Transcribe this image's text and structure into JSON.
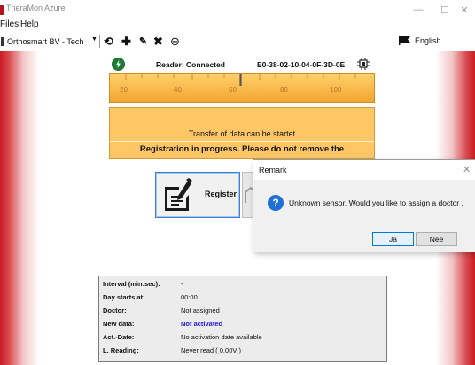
{
  "window": {
    "title": "TheraMon Azure",
    "minimize_glyph": "—",
    "maximize_glyph": "☐",
    "close_glyph": "✕"
  },
  "menu": {
    "files": "Files",
    "help": "Help"
  },
  "toolbar": {
    "profile": "Orthosmart BV - Tech",
    "language": "English",
    "icons": [
      "refresh-icon",
      "add-icon",
      "edit-icon",
      "delete-icon",
      "globe-icon",
      "flag-icon"
    ]
  },
  "reader": {
    "status": "Reader: Connected",
    "sensor_id": "E0-38-02-10-04-0F-3D-0E"
  },
  "gauge": {
    "labels": [
      "20",
      "40",
      "60",
      "80",
      "100"
    ]
  },
  "transfer": {
    "message": "Transfer of data can be startet",
    "registration": "Registration in progress. Please do not remove the"
  },
  "register_button": {
    "label": "Register"
  },
  "dialog": {
    "title": "Remark",
    "close_glyph": "✕",
    "icon_glyph": "?",
    "message": "Unknown sensor. Would you like to assign a doctor .",
    "yes_label": "Ja",
    "no_label": "Nee"
  },
  "info": {
    "interval_label": "Interval (min:sec):",
    "interval_value": "-",
    "day_start_label": "Day starts at:",
    "day_start_value": "00:00",
    "doctor_label": "Doctor:",
    "doctor_value": "Not assigned",
    "new_data_label": "New data:",
    "new_data_value": "Not activated",
    "act_date_label": "Act.-Date:",
    "act_date_value": "No activation date available",
    "reading_label": "L. Reading:",
    "reading_value": "Never read ( 0.00V )"
  },
  "colors": {
    "accent_red": "#c81c22",
    "gauge_orange": "#f3a531",
    "panel_orange": "#ffc666",
    "link_blue": "#1b1be0",
    "power_green": "#1e7a34"
  }
}
